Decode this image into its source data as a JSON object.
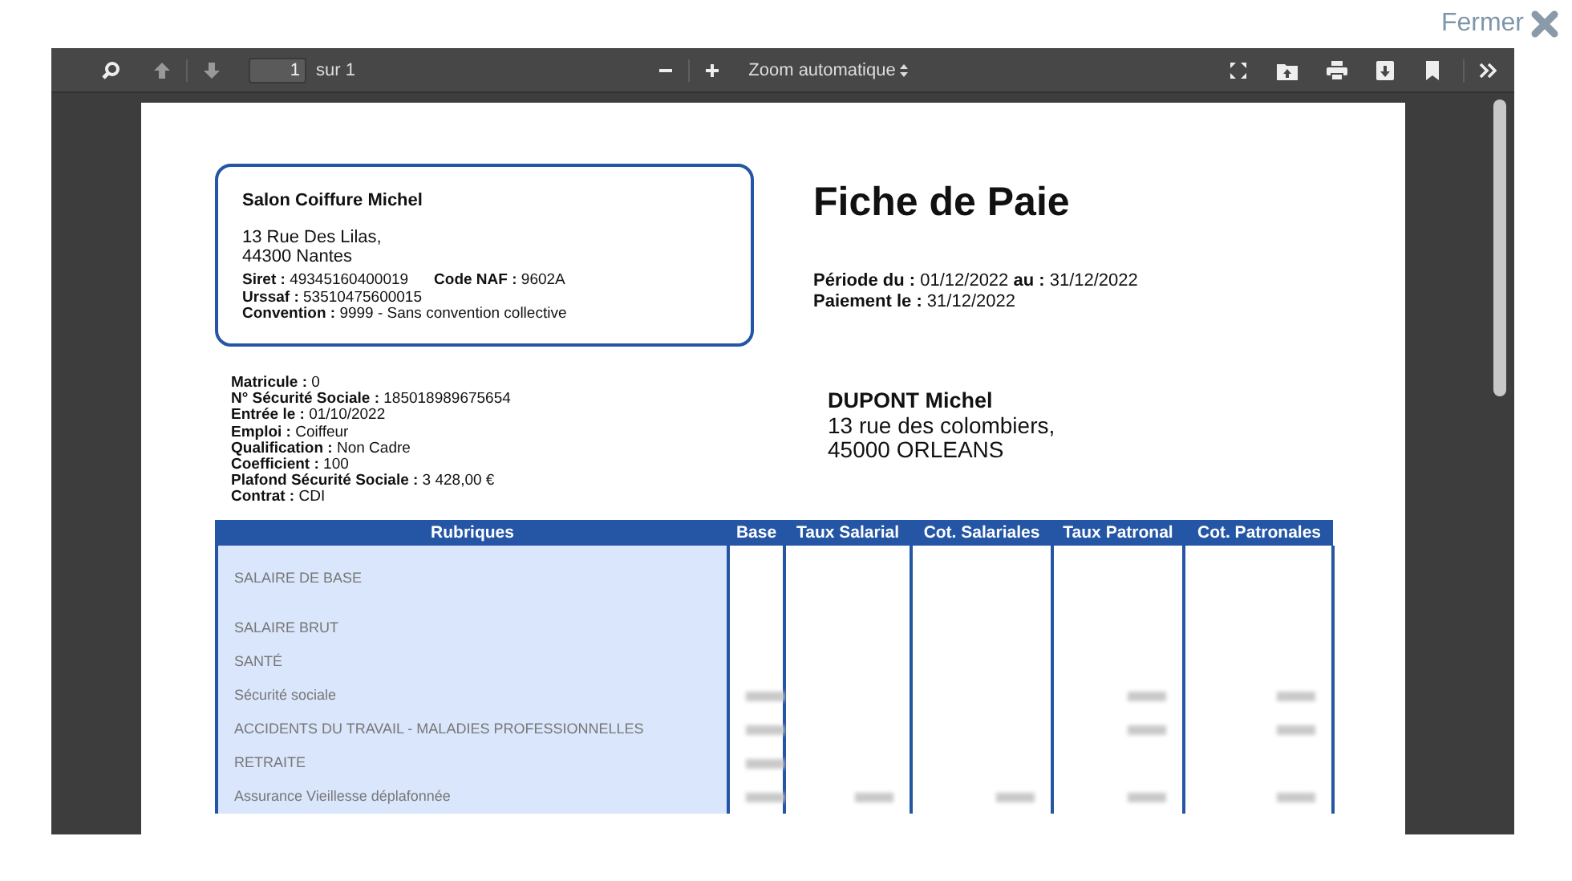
{
  "close_button": {
    "label": "Fermer"
  },
  "toolbar": {
    "page_number": "1",
    "page_count": "sur 1",
    "zoom": "Zoom automatique"
  },
  "employer": {
    "name": "Salon Coiffure Michel",
    "address": [
      "13 Rue Des Lilas,",
      "44300 Nantes"
    ],
    "details": [
      "**Siret :** 49345160400019",
      "**Code NAF :** 9602A",
      "**Urssaf :** 53510475600015",
      "**Convention :** 9999 - Sans convention collective"
    ]
  },
  "document": {
    "title": "Fiche de Paie",
    "period": "**Période du :** 01/12/2022 **au :** 31/12/2022",
    "payment": "**Paiement le :** 31/12/2022"
  },
  "employee_details": [
    "**Matricule :** 0",
    "**N° Sécurité Sociale :** 185018989675654",
    "**Entrée le :** 01/10/2022",
    "**Emploi :** Coiffeur",
    "**Qualification :** Non Cadre",
    "**Coefficient :** 100",
    "**Plafond Sécurité Sociale :** 3 428,00 €",
    "**Contrat :** CDI"
  ],
  "employee": {
    "name": "DUPONT Michel",
    "address": [
      "13 rue des colombiers,",
      "45000 ORLEANS"
    ]
  },
  "table": {
    "columns": [
      "Rubriques",
      "Base",
      "Taux Salarial",
      "Cot. Salariales",
      "Taux Patronal",
      "Cot. Patronales"
    ],
    "rows": [
      {
        "label": "SALAIRE DE BASE",
        "kind": "tall",
        "masked": [
          false,
          false,
          false,
          false,
          false
        ]
      },
      {
        "label": "SALAIRE BRUT",
        "kind": "normal",
        "masked": [
          false,
          false,
          false,
          false,
          false
        ]
      },
      {
        "label": "SANTÉ",
        "kind": "normal",
        "masked": [
          false,
          false,
          false,
          false,
          false
        ]
      },
      {
        "label": "Sécurité sociale",
        "kind": "normal",
        "masked": [
          true,
          false,
          false,
          true,
          true
        ]
      },
      {
        "label": "ACCIDENTS DU TRAVAIL - MALADIES PROFESSIONNELLES",
        "kind": "normal",
        "masked": [
          true,
          false,
          false,
          true,
          true
        ]
      },
      {
        "label": "RETRAITE",
        "kind": "normal",
        "masked": [
          true,
          false,
          false,
          false,
          false
        ]
      },
      {
        "label": "Assurance Vieillesse déplafonnée",
        "kind": "normal",
        "masked": [
          true,
          true,
          true,
          true,
          true
        ]
      }
    ]
  }
}
